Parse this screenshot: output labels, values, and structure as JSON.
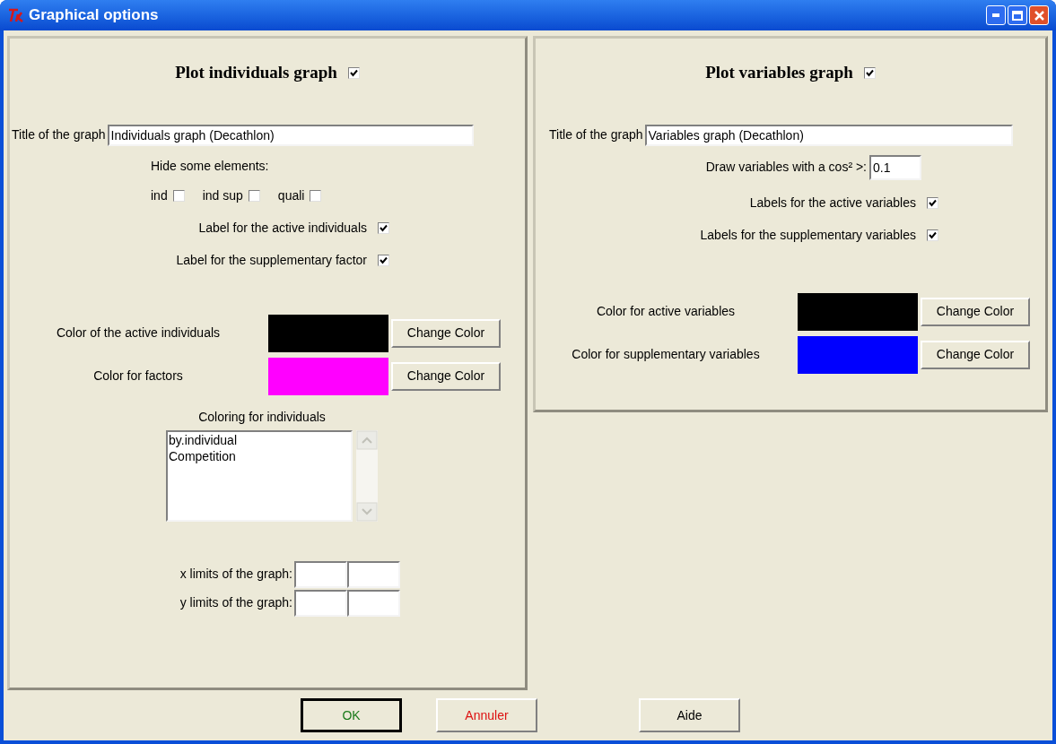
{
  "window": {
    "title": "Graphical options"
  },
  "individuals": {
    "heading": "Plot individuals graph",
    "checked": true,
    "title_label": "Title of the graph",
    "title_value": "Individuals graph (Decathlon)",
    "hide_label": "Hide some elements:",
    "hide": [
      {
        "label": "ind",
        "checked": false
      },
      {
        "label": "ind sup",
        "checked": false
      },
      {
        "label": "quali",
        "checked": false
      }
    ],
    "options": [
      {
        "label": "Label for the active individuals",
        "checked": true
      },
      {
        "label": "Label for the supplementary factor",
        "checked": true
      }
    ],
    "colors": [
      {
        "label": "Color of the active individuals",
        "color": "#000000",
        "button": "Change Color"
      },
      {
        "label": "Color for factors",
        "color": "#ff00ff",
        "button": "Change Color"
      }
    ],
    "coloring_label": "Coloring for individuals",
    "coloring_items": [
      "by.individual",
      "Competition"
    ],
    "limits": [
      {
        "label": "x limits of the graph:"
      },
      {
        "label": "y limits of the graph:"
      }
    ]
  },
  "variables": {
    "heading": "Plot variables graph",
    "checked": true,
    "title_label": "Title of the graph",
    "title_value": "Variables graph (Decathlon)",
    "cos_label": "Draw variables with a cos² >:",
    "cos_value": "0.1",
    "options": [
      {
        "label": "Labels for the active variables",
        "checked": true
      },
      {
        "label": "Labels for the supplementary variables",
        "checked": true
      }
    ],
    "colors": [
      {
        "label": "Color for active variables",
        "color": "#000000",
        "button": "Change Color"
      },
      {
        "label": "Color for supplementary variables",
        "color": "#0000ff",
        "button": "Change Color"
      }
    ]
  },
  "buttons": [
    {
      "label": "OK",
      "color": "#1a7a1a",
      "default": true
    },
    {
      "label": "Annuler",
      "color": "#dd1111",
      "default": false
    },
    {
      "label": "Aide",
      "color": "#000000",
      "default": false
    }
  ]
}
